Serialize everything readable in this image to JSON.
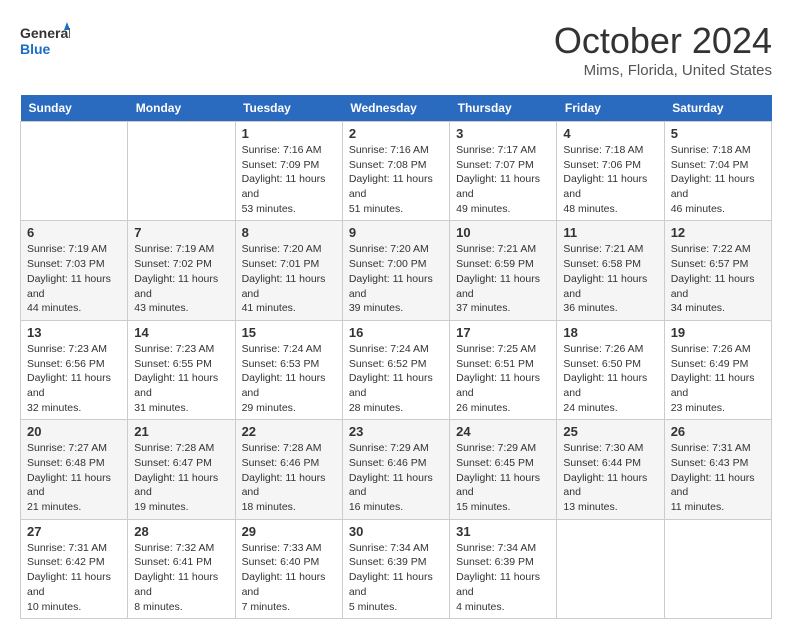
{
  "header": {
    "logo_line1": "General",
    "logo_line2": "Blue",
    "month_title": "October 2024",
    "location": "Mims, Florida, United States"
  },
  "calendar": {
    "days_of_week": [
      "Sunday",
      "Monday",
      "Tuesday",
      "Wednesday",
      "Thursday",
      "Friday",
      "Saturday"
    ],
    "weeks": [
      [
        {
          "day": "",
          "info": ""
        },
        {
          "day": "",
          "info": ""
        },
        {
          "day": "1",
          "info": "Sunrise: 7:16 AM\nSunset: 7:09 PM\nDaylight: 11 hours and 53 minutes."
        },
        {
          "day": "2",
          "info": "Sunrise: 7:16 AM\nSunset: 7:08 PM\nDaylight: 11 hours and 51 minutes."
        },
        {
          "day": "3",
          "info": "Sunrise: 7:17 AM\nSunset: 7:07 PM\nDaylight: 11 hours and 49 minutes."
        },
        {
          "day": "4",
          "info": "Sunrise: 7:18 AM\nSunset: 7:06 PM\nDaylight: 11 hours and 48 minutes."
        },
        {
          "day": "5",
          "info": "Sunrise: 7:18 AM\nSunset: 7:04 PM\nDaylight: 11 hours and 46 minutes."
        }
      ],
      [
        {
          "day": "6",
          "info": "Sunrise: 7:19 AM\nSunset: 7:03 PM\nDaylight: 11 hours and 44 minutes."
        },
        {
          "day": "7",
          "info": "Sunrise: 7:19 AM\nSunset: 7:02 PM\nDaylight: 11 hours and 43 minutes."
        },
        {
          "day": "8",
          "info": "Sunrise: 7:20 AM\nSunset: 7:01 PM\nDaylight: 11 hours and 41 minutes."
        },
        {
          "day": "9",
          "info": "Sunrise: 7:20 AM\nSunset: 7:00 PM\nDaylight: 11 hours and 39 minutes."
        },
        {
          "day": "10",
          "info": "Sunrise: 7:21 AM\nSunset: 6:59 PM\nDaylight: 11 hours and 37 minutes."
        },
        {
          "day": "11",
          "info": "Sunrise: 7:21 AM\nSunset: 6:58 PM\nDaylight: 11 hours and 36 minutes."
        },
        {
          "day": "12",
          "info": "Sunrise: 7:22 AM\nSunset: 6:57 PM\nDaylight: 11 hours and 34 minutes."
        }
      ],
      [
        {
          "day": "13",
          "info": "Sunrise: 7:23 AM\nSunset: 6:56 PM\nDaylight: 11 hours and 32 minutes."
        },
        {
          "day": "14",
          "info": "Sunrise: 7:23 AM\nSunset: 6:55 PM\nDaylight: 11 hours and 31 minutes."
        },
        {
          "day": "15",
          "info": "Sunrise: 7:24 AM\nSunset: 6:53 PM\nDaylight: 11 hours and 29 minutes."
        },
        {
          "day": "16",
          "info": "Sunrise: 7:24 AM\nSunset: 6:52 PM\nDaylight: 11 hours and 28 minutes."
        },
        {
          "day": "17",
          "info": "Sunrise: 7:25 AM\nSunset: 6:51 PM\nDaylight: 11 hours and 26 minutes."
        },
        {
          "day": "18",
          "info": "Sunrise: 7:26 AM\nSunset: 6:50 PM\nDaylight: 11 hours and 24 minutes."
        },
        {
          "day": "19",
          "info": "Sunrise: 7:26 AM\nSunset: 6:49 PM\nDaylight: 11 hours and 23 minutes."
        }
      ],
      [
        {
          "day": "20",
          "info": "Sunrise: 7:27 AM\nSunset: 6:48 PM\nDaylight: 11 hours and 21 minutes."
        },
        {
          "day": "21",
          "info": "Sunrise: 7:28 AM\nSunset: 6:47 PM\nDaylight: 11 hours and 19 minutes."
        },
        {
          "day": "22",
          "info": "Sunrise: 7:28 AM\nSunset: 6:46 PM\nDaylight: 11 hours and 18 minutes."
        },
        {
          "day": "23",
          "info": "Sunrise: 7:29 AM\nSunset: 6:46 PM\nDaylight: 11 hours and 16 minutes."
        },
        {
          "day": "24",
          "info": "Sunrise: 7:29 AM\nSunset: 6:45 PM\nDaylight: 11 hours and 15 minutes."
        },
        {
          "day": "25",
          "info": "Sunrise: 7:30 AM\nSunset: 6:44 PM\nDaylight: 11 hours and 13 minutes."
        },
        {
          "day": "26",
          "info": "Sunrise: 7:31 AM\nSunset: 6:43 PM\nDaylight: 11 hours and 11 minutes."
        }
      ],
      [
        {
          "day": "27",
          "info": "Sunrise: 7:31 AM\nSunset: 6:42 PM\nDaylight: 11 hours and 10 minutes."
        },
        {
          "day": "28",
          "info": "Sunrise: 7:32 AM\nSunset: 6:41 PM\nDaylight: 11 hours and 8 minutes."
        },
        {
          "day": "29",
          "info": "Sunrise: 7:33 AM\nSunset: 6:40 PM\nDaylight: 11 hours and 7 minutes."
        },
        {
          "day": "30",
          "info": "Sunrise: 7:34 AM\nSunset: 6:39 PM\nDaylight: 11 hours and 5 minutes."
        },
        {
          "day": "31",
          "info": "Sunrise: 7:34 AM\nSunset: 6:39 PM\nDaylight: 11 hours and 4 minutes."
        },
        {
          "day": "",
          "info": ""
        },
        {
          "day": "",
          "info": ""
        }
      ]
    ]
  }
}
